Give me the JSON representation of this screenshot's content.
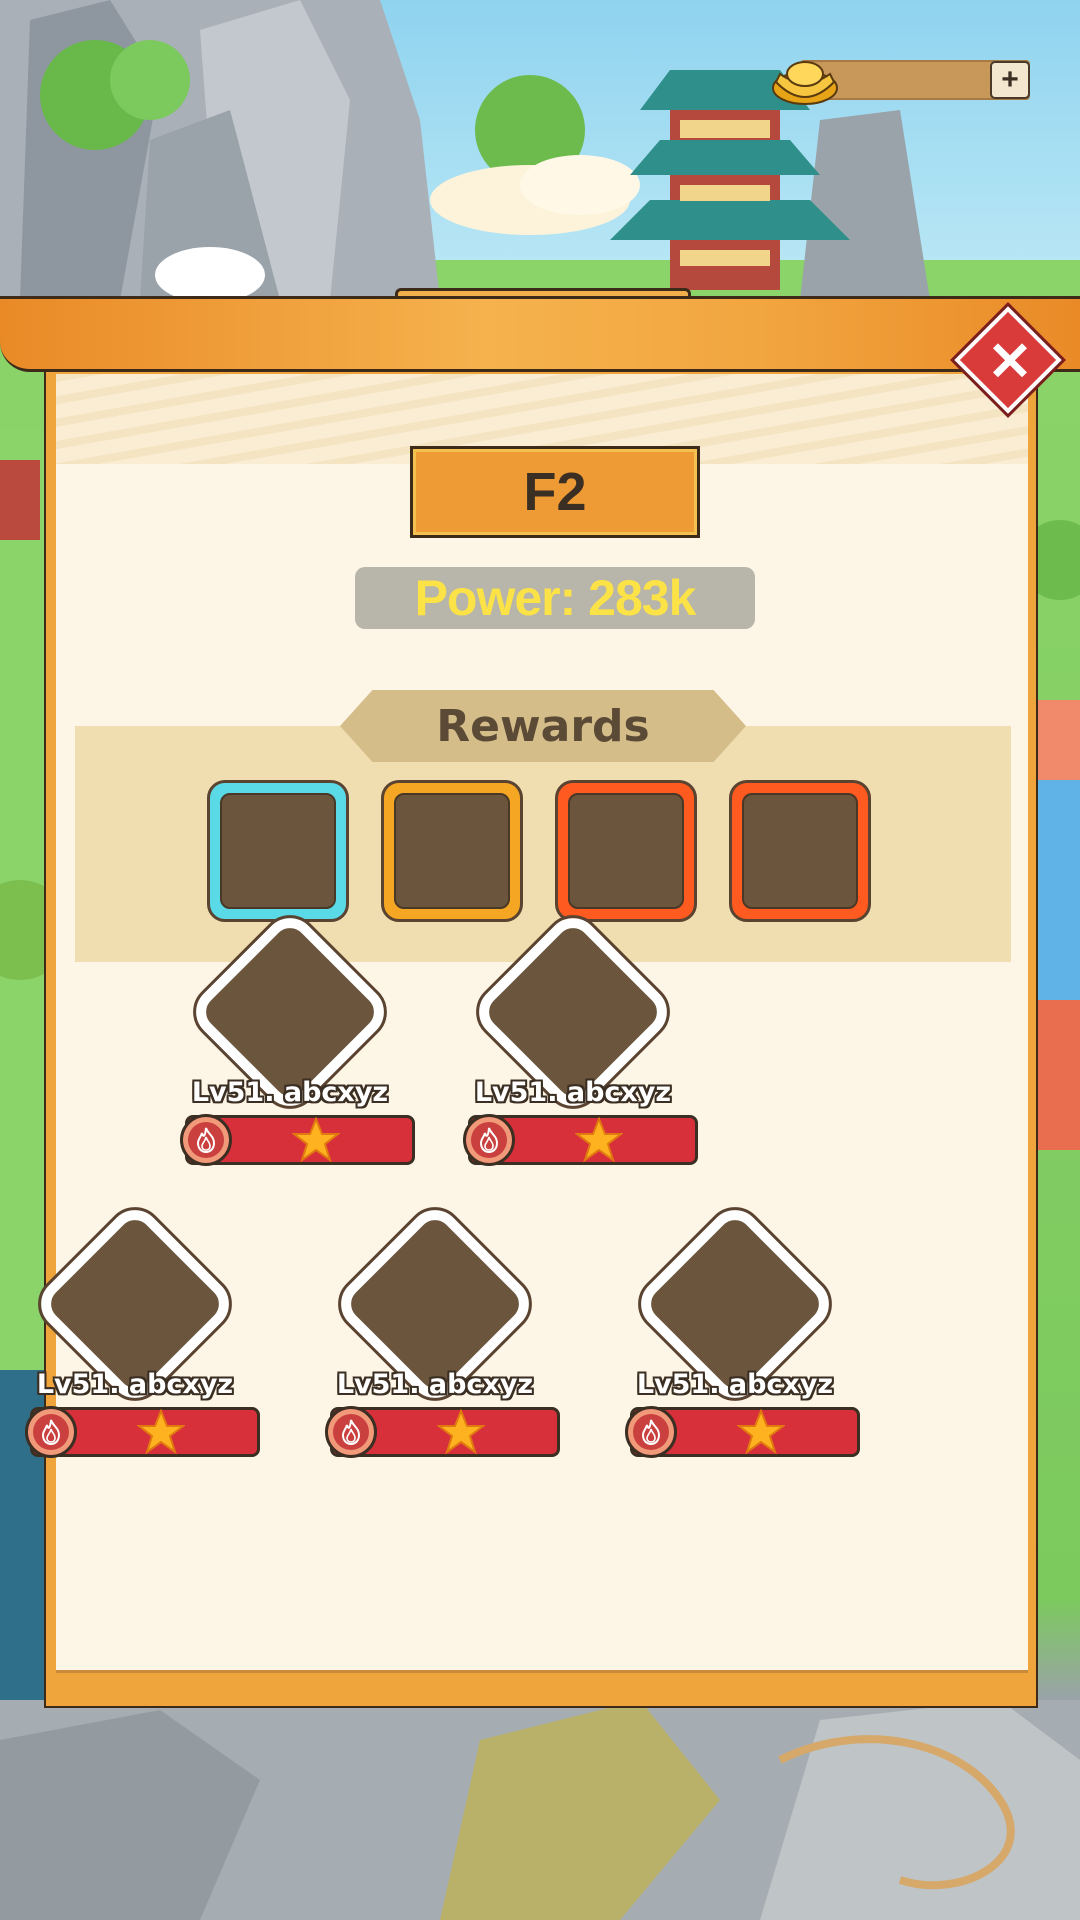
{
  "currency": {
    "plus_label": "+",
    "icon": "gold-ingot-icon"
  },
  "modal": {
    "close_label": "✕"
  },
  "floor": {
    "label": "F2"
  },
  "power": {
    "text": "Power: 283k"
  },
  "rewards": {
    "title": "Rewards",
    "slots": [
      {
        "rarity_color": "#5ad9e6"
      },
      {
        "rarity_color": "#f5a623"
      },
      {
        "rarity_color": "#ff5a1f"
      },
      {
        "rarity_color": "#ff5a1f"
      }
    ]
  },
  "team": {
    "heroes": [
      {
        "name": "Lv51. abcxyz",
        "element": "fire-element-icon",
        "stars": 1
      },
      {
        "name": "Lv51. abcxyz",
        "element": "fire-element-icon",
        "stars": 1
      },
      {
        "name": "Lv51. abcxyz",
        "element": "fire-element-icon",
        "stars": 1
      },
      {
        "name": "Lv51. abcxyz",
        "element": "fire-element-icon",
        "stars": 1
      },
      {
        "name": "Lv51. abcxyz",
        "element": "fire-element-icon",
        "stars": 1
      }
    ]
  }
}
